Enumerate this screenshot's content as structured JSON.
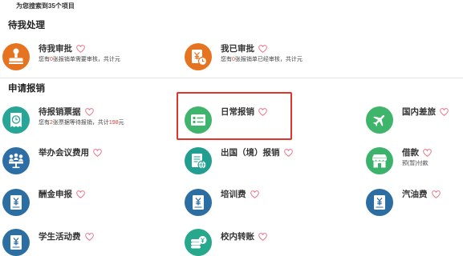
{
  "search_summary": {
    "prefix": "为您搜索到",
    "count": "35",
    "suffix": "个项目"
  },
  "colors": {
    "heart": "#e8758a",
    "highlight_number": "#e53935",
    "selection_frame": "#e3342c",
    "divider": "#e6e6e6"
  },
  "sections": [
    {
      "title": "待我处理",
      "items": [
        {
          "title": "待我审批",
          "icon": "stamp-icon",
          "color": "#e6731f",
          "favorite": false,
          "subtitle": {
            "before": "您有",
            "count": "0",
            "after": "张报销单需要审核，共计元"
          }
        },
        {
          "title": "我已审批",
          "icon": "approved-document-icon",
          "color": "#e6731f",
          "favorite": false,
          "subtitle": {
            "before": "您有",
            "count": "0",
            "after": "张报销单已经审核，共计元"
          }
        }
      ]
    },
    {
      "title": "申请报销",
      "items": [
        {
          "title": "待报销票据",
          "icon": "receipt-clock-icon",
          "color": "#27a596",
          "favorite": false,
          "subtitle": {
            "before": "您有",
            "count": "2",
            "middle": "张票据等待报销，共计",
            "amount": "198",
            "after": "元"
          }
        },
        {
          "title": "日常报销",
          "icon": "id-card-icon",
          "color": "#3fb46d",
          "favorite": false,
          "selected": true
        },
        {
          "title": "国内差旅",
          "icon": "airplane-icon",
          "color": "#3fb56b",
          "favorite": false
        },
        {
          "title": "举办会议费用",
          "icon": "meeting-icon",
          "color": "#2d6ea4",
          "favorite": false
        },
        {
          "title": "出国（境）报销",
          "icon": "passport-globe-icon",
          "color": "#229e90",
          "favorite": false
        },
        {
          "title": "借款",
          "icon": "shop-icon",
          "color": "#3bb36c",
          "favorite": false,
          "subtitle": {
            "text": "预(暂)付款"
          }
        },
        {
          "title": "酬金申报",
          "icon": "yen-document-icon",
          "color": "#2c6ea2",
          "favorite": false
        },
        {
          "title": "培训费",
          "icon": "yen-document-icon",
          "color": "#2c6ea2",
          "favorite": false
        },
        {
          "title": "汽油费",
          "icon": "yen-document-icon",
          "color": "#2c6ea2",
          "favorite": false
        },
        {
          "title": "学生活动费",
          "icon": "yen-document-icon",
          "color": "#2c6ea2",
          "favorite": false
        },
        {
          "title": "校内转账",
          "icon": "coin-stack-icon",
          "color": "#27a78b",
          "favorite": false
        }
      ]
    }
  ]
}
